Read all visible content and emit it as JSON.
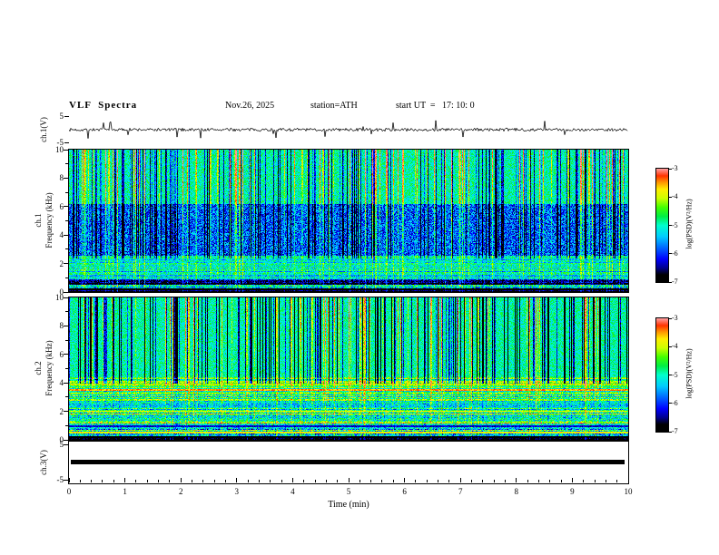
{
  "header": {
    "title": "VLF  Spectra",
    "date": "Nov.26, 2025",
    "station": "station=ATH",
    "start_ut": "start UT  =   17: 10: 0"
  },
  "panels": {
    "ch1_wave": {
      "ylabel": "ch.1(V)",
      "ytick_top": "5",
      "ytick_bottom": "-5"
    },
    "ch1_spec": {
      "channel": "ch.1",
      "ylabel": "Frequency (kHz)",
      "yticks": [
        "10",
        "8",
        "6",
        "4",
        "2",
        "0"
      ]
    },
    "ch2_spec": {
      "channel": "ch.2",
      "ylabel": "Frequency (kHz)",
      "yticks": [
        "10",
        "8",
        "6",
        "4",
        "2",
        "0"
      ]
    },
    "ch3_wave": {
      "ylabel": "ch.3(V)",
      "ytick_top": "5",
      "ytick_bottom": "-5"
    }
  },
  "xaxis": {
    "ticks": [
      "0",
      "1",
      "2",
      "3",
      "4",
      "5",
      "6",
      "7",
      "8",
      "9",
      "10"
    ],
    "label": "Time  (min)"
  },
  "colorbar": {
    "ticks": [
      "-3",
      "-4",
      "-5",
      "-6",
      "-7"
    ],
    "label": "log(PSD)(V²/Hz)",
    "stops": [
      {
        "t": 0.0,
        "color": "#000000"
      },
      {
        "t": 0.06,
        "color": "#000000"
      },
      {
        "t": 0.12,
        "color": "#00008b"
      },
      {
        "t": 0.2,
        "color": "#0000ff"
      },
      {
        "t": 0.3,
        "color": "#0066ff"
      },
      {
        "t": 0.4,
        "color": "#00ccff"
      },
      {
        "t": 0.5,
        "color": "#00ffcc"
      },
      {
        "t": 0.58,
        "color": "#00ee44"
      },
      {
        "t": 0.66,
        "color": "#44ff00"
      },
      {
        "t": 0.74,
        "color": "#ccff00"
      },
      {
        "t": 0.82,
        "color": "#ffee00"
      },
      {
        "t": 0.88,
        "color": "#ff9900"
      },
      {
        "t": 0.94,
        "color": "#ff3300"
      },
      {
        "t": 1.0,
        "color": "#ff9999"
      }
    ]
  },
  "chart_data": [
    {
      "type": "line",
      "name": "ch1-voltage-waveform",
      "title": "ch.1(V)",
      "xlabel": "Time (min)",
      "ylabel": "ch.1(V)",
      "xlim": [
        0,
        10
      ],
      "ylim": [
        -5,
        5
      ],
      "description": "Broadband noise centered on 0 V with sparse impulsive spikes up to about ±4 V across the full 10 minutes",
      "color": "#000000",
      "render": {
        "seed": 7,
        "noise_amp_v": 0.5,
        "spike_prob": 0.035,
        "spike_amp_v": 3.2
      }
    },
    {
      "type": "heatmap",
      "name": "ch1-spectrogram",
      "title": "ch.1 spectrogram",
      "xlabel": "Time (min)",
      "ylabel": "Frequency (kHz)",
      "xlim": [
        0,
        10
      ],
      "ylim": [
        0,
        10
      ],
      "zlabel": "log(PSD)(V²/Hz)",
      "zlim": [
        -7,
        -3
      ],
      "features": [
        "green background above ~6 kHz with frequent red/yellow impulsive vertical streaks (sferics)",
        "suppressed blue band ~2.6-6.2 kHz crossed by dark and green vertical streaks",
        "cyan band ~1-2.6 kHz with fine horizontal striping",
        "dark blue band ~0.55-0.95 kHz and near-black band below ~0.3 kHz"
      ],
      "render": {
        "seed": 42,
        "bands": [
          {
            "f": [
              0.0,
              0.3
            ],
            "base": -6.9,
            "noise": 0.25
          },
          {
            "f": [
              0.3,
              0.55
            ],
            "base": -5.4,
            "noise": 0.9
          },
          {
            "f": [
              0.55,
              0.95
            ],
            "base": -6.5,
            "noise": 0.6
          },
          {
            "f": [
              0.95,
              2.6
            ],
            "base": -5.15,
            "noise": 0.55
          },
          {
            "f": [
              2.6,
              6.2
            ],
            "base": -5.85,
            "noise": 0.75
          },
          {
            "f": [
              6.2,
              10.0
            ],
            "base": -4.95,
            "noise": 0.5
          }
        ],
        "stripes": {
          "fmax": 2.6,
          "amp": 0.5
        },
        "streaks": {
          "pos_density": 0.17,
          "pos_amp": 1.6,
          "neg_density": 0.2,
          "neg_amp": 1.3,
          "neg_fmin": 2.4
        },
        "lines": []
      }
    },
    {
      "type": "heatmap",
      "name": "ch2-spectrogram",
      "title": "ch.2 spectrogram",
      "xlabel": "Time (min)",
      "ylabel": "Frequency (kHz)",
      "xlim": [
        0,
        10
      ],
      "ylim": [
        0,
        10
      ],
      "zlabel": "log(PSD)(V²/Hz)",
      "zlim": [
        -7,
        -3
      ],
      "features": [
        "green background above ~4.5 kHz with many dark-blue vertical streaks and a few red/yellow ones",
        "strong yellow/orange horizontal banding below ~4.5 kHz",
        "bright narrow lines near 3.55, 2.05 and 0.55 kHz; dark line near 1.0 kHz",
        "near-black band below ~0.3 kHz"
      ],
      "render": {
        "seed": 1337,
        "bands": [
          {
            "f": [
              0.0,
              0.3
            ],
            "base": -6.8,
            "noise": 0.3
          },
          {
            "f": [
              0.3,
              0.8
            ],
            "base": -5.0,
            "noise": 0.9
          },
          {
            "f": [
              0.8,
              2.0
            ],
            "base": -4.55,
            "noise": 0.7
          },
          {
            "f": [
              2.0,
              3.5
            ],
            "base": -4.8,
            "noise": 0.6
          },
          {
            "f": [
              3.5,
              4.5
            ],
            "base": -4.45,
            "noise": 0.5
          },
          {
            "f": [
              4.5,
              10.0
            ],
            "base": -4.95,
            "noise": 0.45
          }
        ],
        "stripes": {
          "fmax": 4.5,
          "amp": 0.75
        },
        "streaks": {
          "pos_density": 0.1,
          "pos_amp": 1.4,
          "neg_density": 0.26,
          "neg_amp": 1.8,
          "neg_fmin": 4.0
        },
        "lines": [
          {
            "f": 3.55,
            "halfw": 0.06,
            "z": -3.5
          },
          {
            "f": 2.05,
            "halfw": 0.05,
            "z": -3.9
          },
          {
            "f": 1.0,
            "halfw": 0.05,
            "z": -6.3
          },
          {
            "f": 0.55,
            "halfw": 0.05,
            "z": -3.8
          }
        ]
      }
    },
    {
      "type": "line",
      "name": "ch3-voltage-flatline",
      "title": "ch.3(V)",
      "xlabel": "Time (min)",
      "xlim": [
        0,
        10
      ],
      "ylim": [
        -5,
        5
      ],
      "constant_value": 0,
      "description": "Dead/flat channel: constant 0 V rendered as a thick black bar across the full panel",
      "color": "#000000"
    }
  ]
}
